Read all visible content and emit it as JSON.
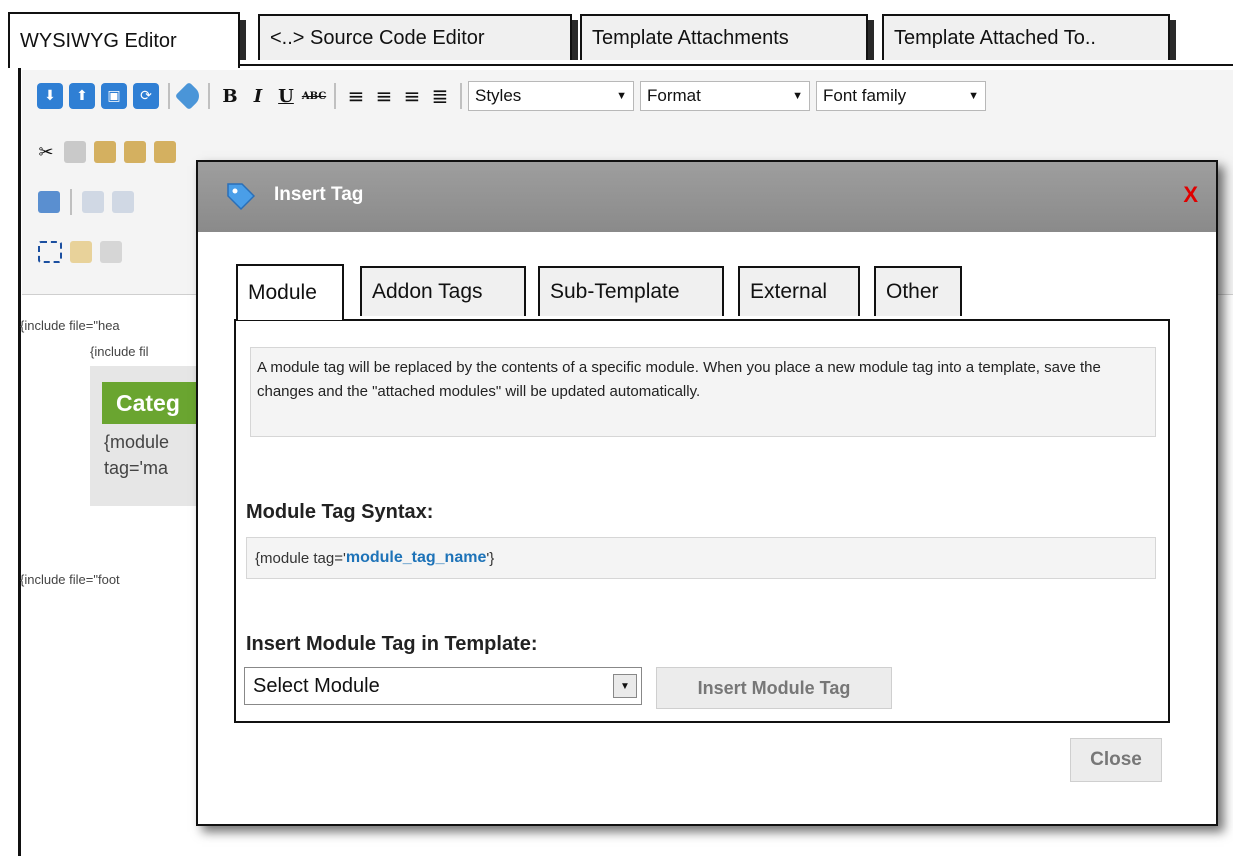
{
  "editor_tabs": [
    {
      "label": "WYSIWYG Editor"
    },
    {
      "label": "<..> Source Code Editor"
    },
    {
      "label": "Template Attachments"
    },
    {
      "label": "Template Attached To.."
    }
  ],
  "toolbar": {
    "styles_select": "Styles",
    "format_select": "Format",
    "font_family_select": "Font family",
    "bold": "B",
    "italic": "I",
    "underline": "U",
    "strike": "ABC"
  },
  "editor_content": {
    "include_header": "{include file=\"hea",
    "include_file2": "{include fil",
    "category_title": "Categ",
    "module_line1": "{module",
    "module_line2": "tag='ma",
    "include_footer": "{include file=\"foot"
  },
  "modal": {
    "title": "Insert Tag",
    "close_x": "X",
    "tabs": [
      {
        "label": "Module"
      },
      {
        "label": "Addon Tags"
      },
      {
        "label": "Sub-Template"
      },
      {
        "label": "External"
      },
      {
        "label": "Other"
      }
    ],
    "description": "A module tag will be replaced by the contents of a specific module. When you place a new module tag into a template, save the changes and the \"attached modules\" will be updated automatically.",
    "syntax_heading": "Module Tag Syntax:",
    "syntax_prefix": "{module tag='",
    "syntax_name": "module_tag_name",
    "syntax_suffix": "'}",
    "insert_heading": "Insert Module Tag in Template:",
    "select_value": "Select Module",
    "insert_button": "Insert Module Tag",
    "close_button": "Close"
  },
  "colors": {
    "header_gray": "#8e8e8e",
    "close_red": "#e00000",
    "syntax_blue": "#1e73b8",
    "category_green": "#6aa530"
  }
}
